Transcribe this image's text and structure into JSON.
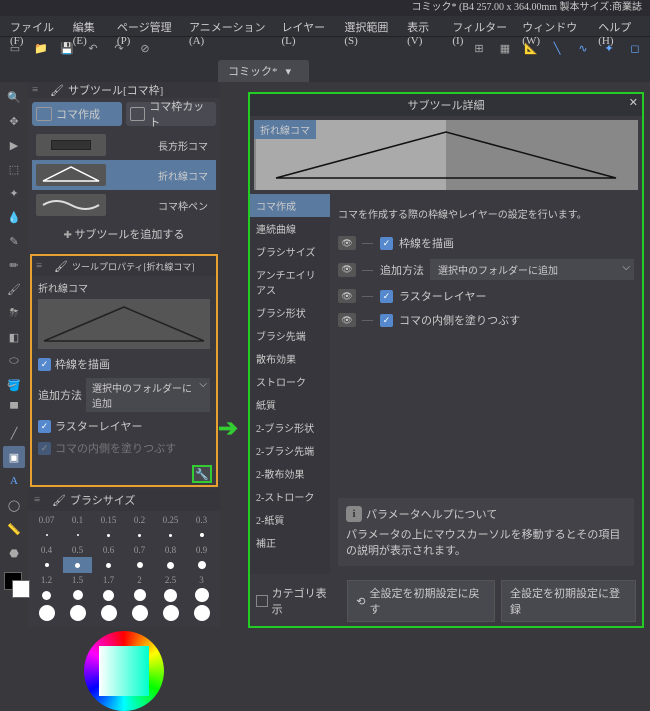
{
  "title": "コミック* (B4 257.00 x 364.00mm 製本サイズ:商業誌",
  "menu": {
    "file": "ファイル(F)",
    "edit": "編集(E)",
    "page": "ページ管理(P)",
    "anim": "アニメーション(A)",
    "layer": "レイヤー(L)",
    "select": "選択範囲(S)",
    "view": "表示(V)",
    "filter": "フィルター(I)",
    "window": "ウィンドウ(W)",
    "help": "ヘルプ(H)"
  },
  "doc_tab": "コミック*",
  "subtool": {
    "header": "サブツール[コマ枠]",
    "tab_create": "コマ作成",
    "tab_cut": "コマ枠カット",
    "items": [
      {
        "label": "長方形コマ"
      },
      {
        "label": "折れ線コマ"
      },
      {
        "label": "コマ枠ペン"
      }
    ],
    "add": "サブツールを追加する"
  },
  "prop": {
    "header": "ツールプロパティ[折れ線コマ]",
    "name": "折れ線コマ",
    "draw_border": "枠線を描画",
    "add_method_label": "追加方法",
    "add_method_value": "選択中のフォルダーに追加",
    "raster": "ラスターレイヤー",
    "fill": "コマの内側を塗りつぶす"
  },
  "brush": {
    "header": "ブラシサイズ",
    "sizes_r1": [
      "0.07",
      "0.1",
      "0.15",
      "0.2",
      "0.25",
      "0.3"
    ],
    "sizes_r2": [
      "0.4",
      "0.5",
      "0.6",
      "0.7",
      "0.8",
      "0.9"
    ],
    "sizes_r3": [
      "1.2",
      "1.5",
      "1.7",
      "2",
      "2.5",
      "3"
    ]
  },
  "dialog": {
    "title": "サブツール詳細",
    "preview_label": "折れ線コマ",
    "categories": [
      "コマ作成",
      "連続曲線",
      "ブラシサイズ",
      "アンチエイリアス",
      "ブラシ形状",
      "ブラシ先端",
      "散布効果",
      "ストローク",
      "紙質",
      "2-ブラシ形状",
      "2-ブラシ先端",
      "2-散布効果",
      "2-ストローク",
      "2-紙質",
      "補正"
    ],
    "desc": "コマを作成する際の枠線やレイヤーの設定を行います。",
    "p_border": "枠線を描画",
    "p_method_label": "追加方法",
    "p_method_value": "選択中のフォルダーに追加",
    "p_raster": "ラスターレイヤー",
    "p_fill": "コマの内側を塗りつぶす",
    "help_title": "パラメータヘルプについて",
    "help_body": "パラメータの上にマウスカーソルを移動するとその項目の説明が表示されます。",
    "cat_show": "カテゴリ表示",
    "reset": "全設定を初期設定に戻す",
    "register": "全設定を初期設定に登録"
  }
}
